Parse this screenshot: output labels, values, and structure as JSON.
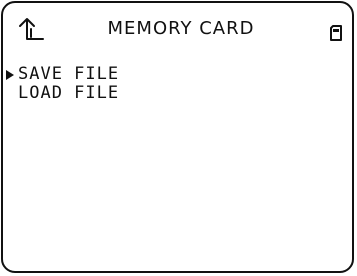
{
  "header": {
    "title": "MEMORY CARD",
    "back_icon": "return-arrow-icon",
    "card_icon": "memory-card-icon"
  },
  "menu": {
    "selected_index": 0,
    "items": [
      {
        "label": "SAVE FILE"
      },
      {
        "label": "LOAD FILE"
      }
    ]
  },
  "colors": {
    "foreground": "#111111",
    "background": "#ffffff"
  }
}
